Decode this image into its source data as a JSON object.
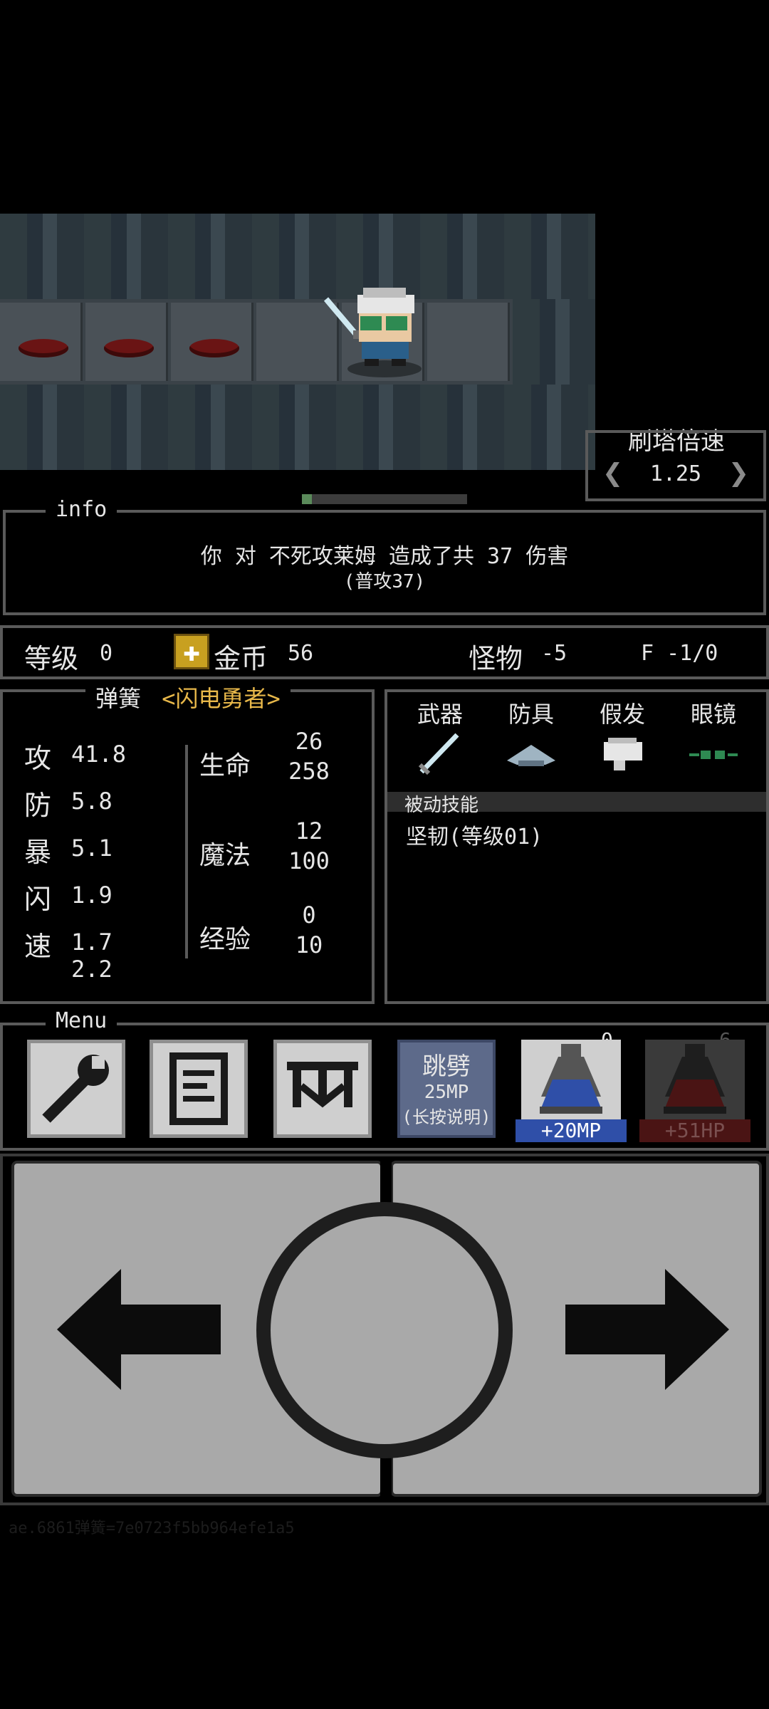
{
  "speed": {
    "title": "刷塔倍速",
    "value": "1.25",
    "left_icon": "chevron-left-icon",
    "right_icon": "chevron-right-icon"
  },
  "progress": {
    "fraction": 0.06
  },
  "info": {
    "title": "info",
    "line1": "你 对 不死攻莱姆 造成了共 37 伤害",
    "line2": "(普攻37)"
  },
  "status": {
    "level_label": "等级",
    "level_value": "0",
    "coin_label": "金币",
    "coin_value": "56",
    "monster_label": "怪物",
    "monster_value": "-5",
    "floor_text": "F -1/0"
  },
  "character": {
    "name": "弹簧",
    "title": "<闪电勇者>",
    "stats": [
      {
        "label": "攻",
        "value": "41.8"
      },
      {
        "label": "防",
        "value": "5.8"
      },
      {
        "label": "暴",
        "value": "5.1"
      },
      {
        "label": "闪",
        "value": "1.9"
      },
      {
        "label": "速",
        "value": "1.7",
        "value2": "2.2"
      }
    ],
    "hp": {
      "label": "生命",
      "current": "26",
      "max": "258"
    },
    "mp": {
      "label": "魔法",
      "current": "12",
      "max": "100"
    },
    "exp": {
      "label": "经验",
      "current": "0",
      "max": "10"
    }
  },
  "equipment": {
    "slots": [
      {
        "label": "武器",
        "icon": "sword-icon"
      },
      {
        "label": "防具",
        "icon": "armor-icon"
      },
      {
        "label": "假发",
        "icon": "wig-icon"
      },
      {
        "label": "眼镜",
        "icon": "glasses-icon"
      }
    ],
    "passive_header": "被动技能",
    "passive_skill": "坚韧(等级01)"
  },
  "menu": {
    "title": "Menu",
    "buttons": [
      {
        "icon": "wrench-icon"
      },
      {
        "icon": "notebook-icon"
      },
      {
        "icon": "map-icon"
      }
    ],
    "skill": {
      "name": "跳劈",
      "cost": "25MP",
      "hint": "(长按说明)"
    },
    "potion_mp": {
      "count": "0",
      "label": "+20MP",
      "icon": "mp-potion-icon"
    },
    "potion_hp": {
      "count": "6",
      "label": "+51HP",
      "icon": "hp-potion-icon"
    }
  },
  "controls": {
    "left_icon": "arrow-left-icon",
    "center_icon": "circle-action-icon",
    "right_icon": "arrow-right-icon"
  },
  "footer": {
    "text": "ae.6861弹簧=7e0723f5bb964efe1a5"
  },
  "colors": {
    "accent_gold": "#e8b84a",
    "mp_blue": "#2f4fa8",
    "hp_red": "#8a2020",
    "panel_border": "#5a5a5a"
  }
}
